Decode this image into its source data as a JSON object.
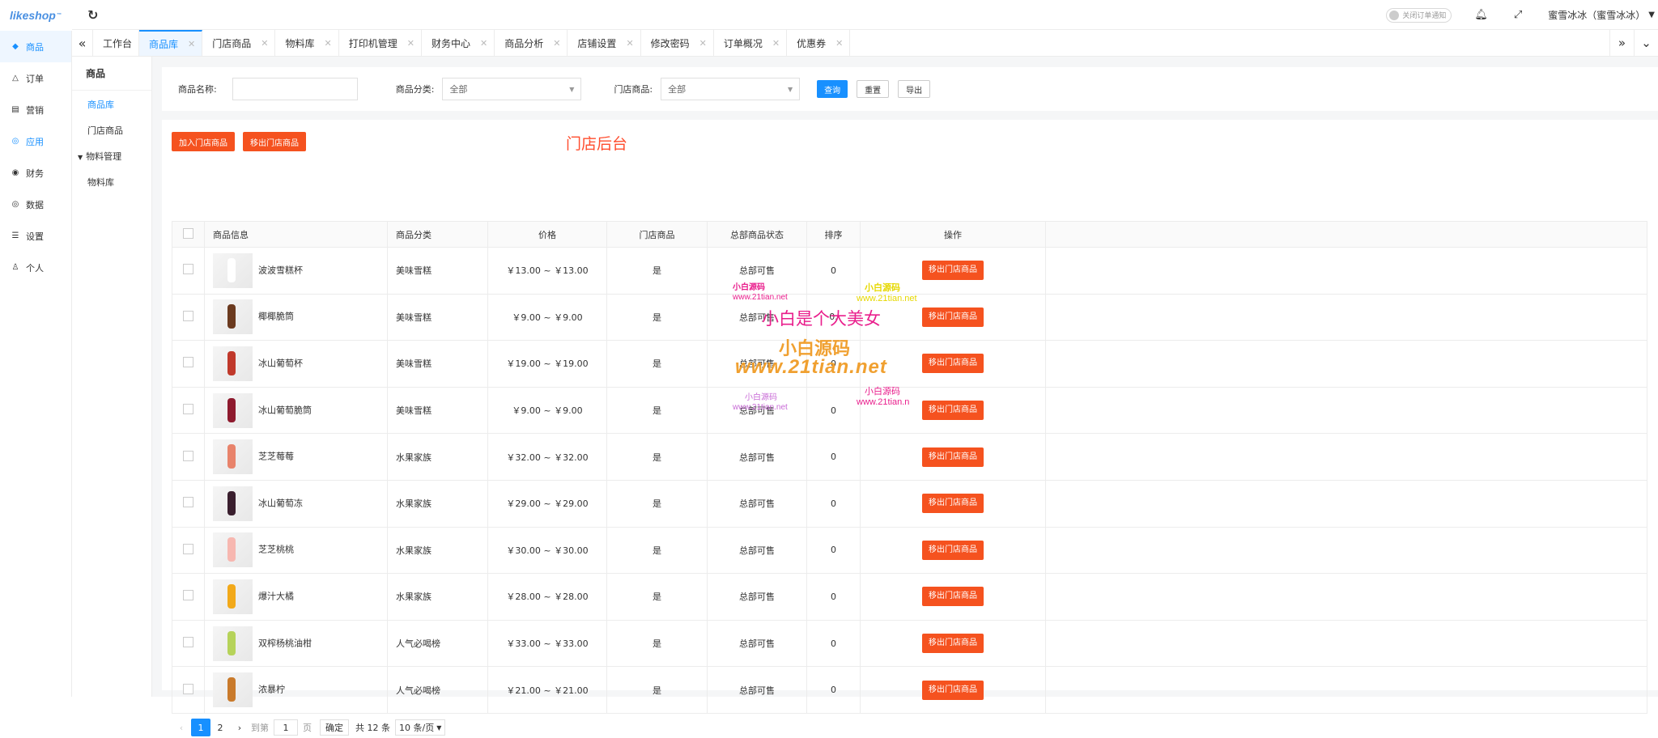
{
  "brand": {
    "logo_text": "likeshop",
    "logo_mark": "™"
  },
  "header": {
    "refresh_icon": "↻",
    "notify_label": "关闭订单通知",
    "user_name": "蜜雪冰冰（蜜雪冰冰）"
  },
  "sidebar": {
    "items": [
      {
        "label": "商品",
        "icon": "gem-icon",
        "glyph": "◆"
      },
      {
        "label": "订单",
        "icon": "bell-icon",
        "glyph": "△"
      },
      {
        "label": "营销",
        "icon": "chart-icon",
        "glyph": "▤"
      },
      {
        "label": "应用",
        "icon": "check-icon",
        "glyph": "◎"
      },
      {
        "label": "财务",
        "icon": "money-icon",
        "glyph": "◉"
      },
      {
        "label": "数据",
        "icon": "data-icon",
        "glyph": "◎"
      },
      {
        "label": "设置",
        "icon": "settings-icon",
        "glyph": "☰"
      },
      {
        "label": "个人",
        "icon": "user-icon",
        "glyph": "♙"
      }
    ]
  },
  "tabs": [
    {
      "label": "工作台",
      "closable": false
    },
    {
      "label": "商品库",
      "closable": true
    },
    {
      "label": "门店商品",
      "closable": true
    },
    {
      "label": "物料库",
      "closable": true
    },
    {
      "label": "打印机管理",
      "closable": true
    },
    {
      "label": "财务中心",
      "closable": true
    },
    {
      "label": "商品分析",
      "closable": true
    },
    {
      "label": "店铺设置",
      "closable": true
    },
    {
      "label": "修改密码",
      "closable": true
    },
    {
      "label": "订单概况",
      "closable": true
    },
    {
      "label": "优惠券",
      "closable": true
    }
  ],
  "subnav": {
    "title": "商品",
    "item1": "商品库",
    "item2": "门店商品",
    "group": "物料管理",
    "item3": "物料库"
  },
  "filter": {
    "name_label": "商品名称:",
    "name_value": "",
    "category_label": "商品分类:",
    "category_value": "全部",
    "store_label": "门店商品:",
    "store_value": "全部",
    "query_button": "查询",
    "reset_button": "重置",
    "export_button": "导出"
  },
  "actions": {
    "add_button": "加入门店商品",
    "remove_button": "移出门店商品",
    "store_title": "门店后台"
  },
  "table": {
    "headers": [
      "商品信息",
      "商品分类",
      "价格",
      "门店商品",
      "总部商品状态",
      "排序",
      "操作"
    ],
    "row_action": "移出门店商品",
    "rows": [
      {
        "name": "波波雪糕杯",
        "category": "美味雪糕",
        "price": "￥13.00 ~ ￥13.00",
        "store": "是",
        "status": "总部可售",
        "sort": "0",
        "thumb_color": "#ffffff"
      },
      {
        "name": "椰椰脆筒",
        "category": "美味雪糕",
        "price": "￥9.00 ~ ￥9.00",
        "store": "是",
        "status": "总部可售",
        "sort": "0.",
        "thumb_color": "#6b3a1f"
      },
      {
        "name": "冰山葡萄杯",
        "category": "美味雪糕",
        "price": "￥19.00 ~ ￥19.00",
        "store": "是",
        "status": "总部可售",
        "sort": "0",
        "thumb_color": "#c0392b"
      },
      {
        "name": "冰山葡萄脆筒",
        "category": "美味雪糕",
        "price": "￥9.00 ~ ￥9.00",
        "store": "是",
        "status": "总部可售",
        "sort": "0",
        "thumb_color": "#8e1a2e"
      },
      {
        "name": "芝芝莓莓",
        "category": "水果家族",
        "price": "￥32.00 ~ ￥32.00",
        "store": "是",
        "status": "总部可售",
        "sort": "0",
        "thumb_color": "#e8836b"
      },
      {
        "name": "冰山葡萄冻",
        "category": "水果家族",
        "price": "￥29.00 ~ ￥29.00",
        "store": "是",
        "status": "总部可售",
        "sort": "0",
        "thumb_color": "#3a1f2e"
      },
      {
        "name": "芝芝桃桃",
        "category": "水果家族",
        "price": "￥30.00 ~ ￥30.00",
        "store": "是",
        "status": "总部可售",
        "sort": "0",
        "thumb_color": "#f7b7b0"
      },
      {
        "name": "爆汁大橘",
        "category": "水果家族",
        "price": "￥28.00 ~ ￥28.00",
        "store": "是",
        "status": "总部可售",
        "sort": "0",
        "thumb_color": "#f2a91a"
      },
      {
        "name": "双榨杨桃油柑",
        "category": "人气必喝榜",
        "price": "￥33.00 ~ ￥33.00",
        "store": "是",
        "status": "总部可售",
        "sort": "0",
        "thumb_color": "#b6d35a"
      },
      {
        "name": "浓暴柠",
        "category": "人气必喝榜",
        "price": "￥21.00 ~ ￥21.00",
        "store": "是",
        "status": "总部可售",
        "sort": "0",
        "thumb_color": "#c97a2b"
      }
    ]
  },
  "pager": {
    "prev": "‹",
    "page1": "1",
    "page2": "2",
    "next": "›",
    "goto_label": "到第",
    "goto_value": "1",
    "page_suffix": "页",
    "confirm": "确定",
    "total": "共 12 条",
    "size": "10 条/页"
  },
  "watermarks": {
    "w1a": "小白源码",
    "w1b": "www.21tian.net",
    "w2a": "小白源码",
    "w2b": "www.21tian.net",
    "big1": "小白是个大美女",
    "big2": "小白源码",
    "big3": "www.21tian.net",
    "w3a": "小白源码",
    "w3b": "www.21tian.net",
    "w4a": "小白源码",
    "w4b": "www.21tian.n"
  },
  "colors": {
    "accent": "#1890ff",
    "danger": "#f5521f"
  }
}
